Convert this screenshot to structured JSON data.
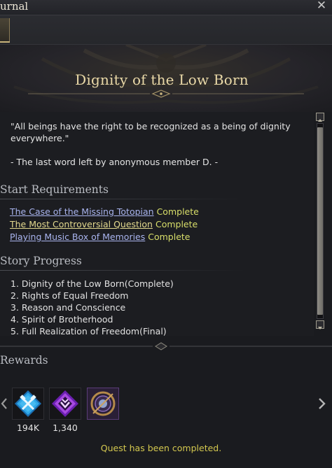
{
  "window": {
    "title": "urnal",
    "close_glyph": "✕"
  },
  "quest": {
    "title": "Dignity of the Low Born"
  },
  "description": {
    "quote": "\"All beings have the right to be recognized as a being of dignity everywhere.\"",
    "signoff": "- The last word left by anonymous member D. -"
  },
  "start_requirements": {
    "heading": "Start Requirements",
    "items": [
      {
        "name": "The Case of the Missing Totopian",
        "status": "Complete",
        "link_color": "#a9b4ee"
      },
      {
        "name": "The Most Controversial Question",
        "status": "Complete",
        "link_color": "#e3d98e"
      },
      {
        "name": "Playing Music Box of Memories",
        "status": "Complete",
        "link_color": "#a9b4ee"
      }
    ]
  },
  "story_progress": {
    "heading": "Story Progress",
    "items": [
      "1. Dignity of the Low Born(Complete)",
      "2. Rights of Equal Freedom",
      "3. Reason and Conscience",
      "4. Spirit of Brotherhood",
      "5. Full Realization of Freedom(Final)"
    ]
  },
  "rewards": {
    "heading": "Rewards",
    "items": [
      {
        "icon": "blue-crossed-hammers-icon",
        "count": "194K",
        "accent": "#2fa8e8"
      },
      {
        "icon": "purple-gem-icon",
        "count": "1,340",
        "accent": "#a64ae0"
      },
      {
        "icon": "compass-ring-icon",
        "count": "",
        "accent": "#8a6ab8"
      }
    ]
  },
  "status_message": "Quest has been completed.",
  "colors": {
    "complete": "#d9df6a",
    "gold_title": "#ead9a8",
    "background": "#1a1b1f"
  }
}
